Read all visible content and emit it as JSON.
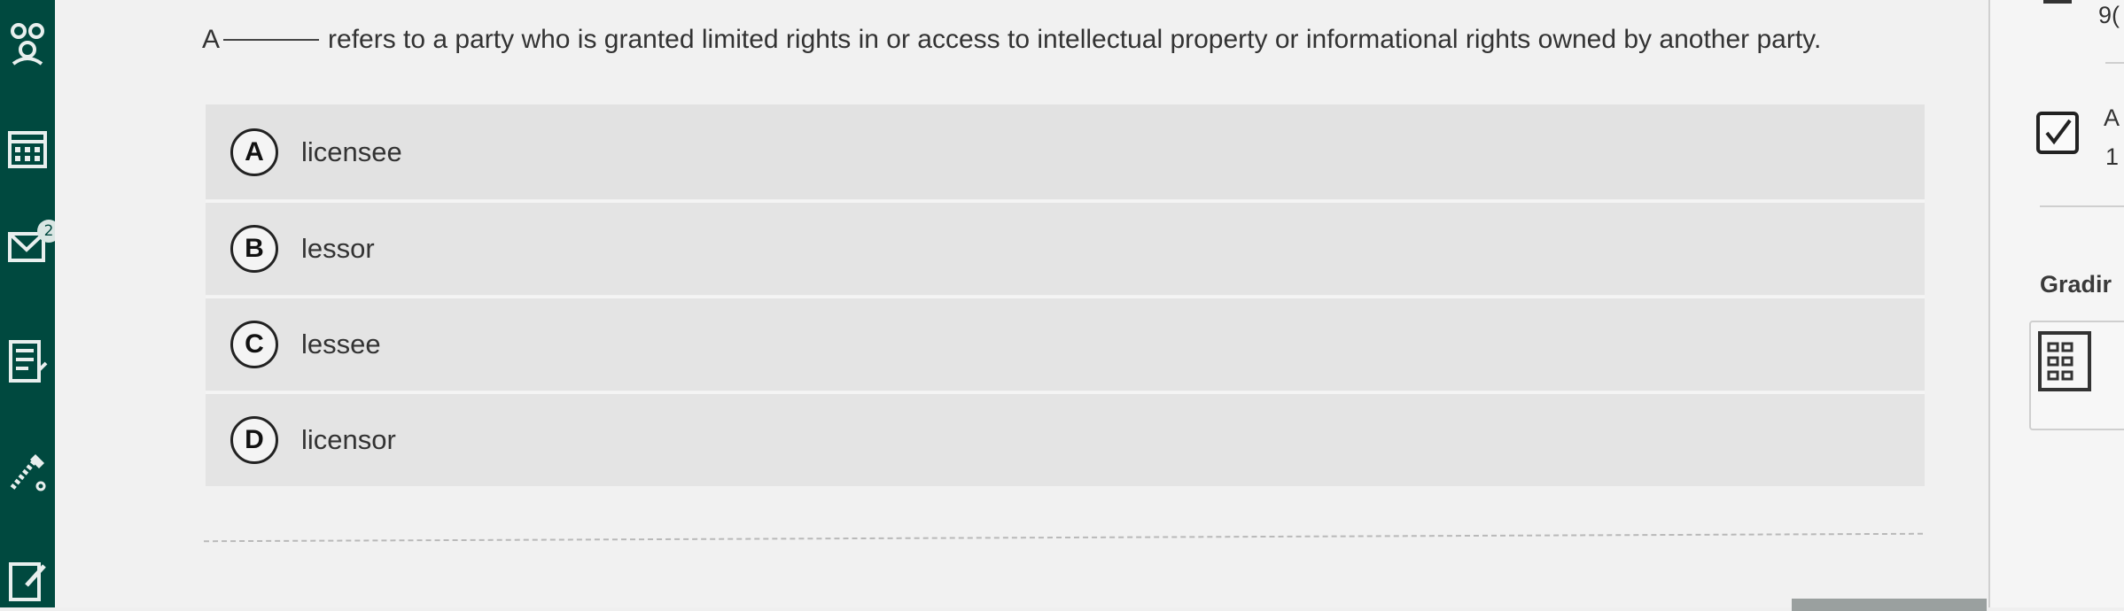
{
  "question": {
    "prefix": "A",
    "suffix": "refers to a party who is granted limited rights in or access to intellectual property or informational rights owned by another party."
  },
  "options": [
    {
      "letter": "A",
      "label": "licensee"
    },
    {
      "letter": "B",
      "label": "lessor"
    },
    {
      "letter": "C",
      "label": "lessee"
    },
    {
      "letter": "D",
      "label": "licensor"
    }
  ],
  "sidebar": {
    "mail_badge": "2"
  },
  "right_panel": {
    "top_value": "9(",
    "answered_label": "A",
    "answered_count": "1",
    "grading_label": "Gradir"
  },
  "colors": {
    "sidebar": "#00493f",
    "option_bg": "#e4e4e4",
    "page_bg": "#f1f1f1"
  }
}
